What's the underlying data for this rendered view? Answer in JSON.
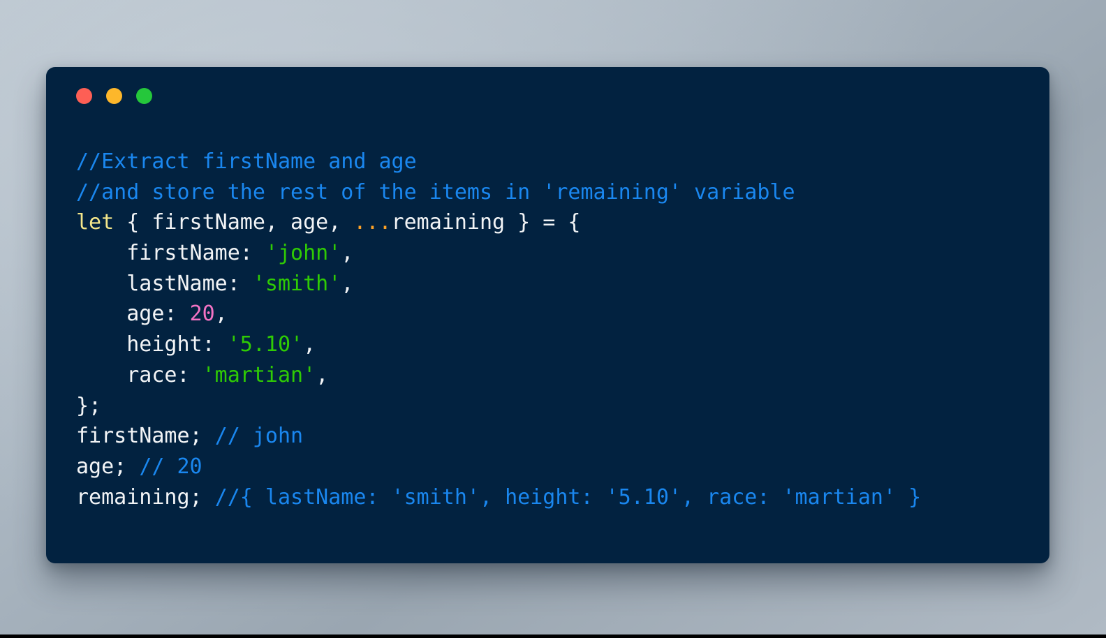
{
  "window": {
    "title": "",
    "traffic_lights": [
      {
        "name": "close",
        "color": "#fd5f55"
      },
      {
        "name": "minimize",
        "color": "#fdb72b"
      },
      {
        "name": "maximize",
        "color": "#25c73b"
      }
    ]
  },
  "theme": {
    "card_background": "#022240",
    "page_background_top": "#b9c4ce",
    "page_background_bottom": "#b0bac4",
    "text": "#f2f4f6",
    "comment": "#1a87ef",
    "keyword": "#f3e68a",
    "spread_operator": "#fda227",
    "string": "#2fcb04",
    "number": "#f373c4"
  },
  "code": {
    "language": "javascript",
    "plain_text": "//Extract firstName and age\n//and store the rest of the items in 'remaining' variable\nlet { firstName, age, ...remaining } = {\n    firstName: 'john',\n    lastName: 'smith',\n    age: 20,\n    height: '5.10',\n    race: 'martian',\n};\nfirstName; // john\nage; // 20\nremaining; //{ lastName: 'smith', height: '5.10', race: 'martian' }",
    "lines": [
      {
        "number": 1,
        "tokens": [
          {
            "t": "comment",
            "v": "//Extract firstName and age"
          }
        ]
      },
      {
        "number": 2,
        "tokens": [
          {
            "t": "comment",
            "v": "//and store the rest of the items in 'remaining' variable"
          }
        ]
      },
      {
        "number": 3,
        "tokens": [
          {
            "t": "kw",
            "v": "let"
          },
          {
            "t": "plain",
            "v": " { firstName, age, "
          },
          {
            "t": "spread",
            "v": "..."
          },
          {
            "t": "plain",
            "v": "remaining } = {"
          }
        ]
      },
      {
        "number": 4,
        "tokens": [
          {
            "t": "plain",
            "v": "    firstName: "
          },
          {
            "t": "str",
            "v": "'john'"
          },
          {
            "t": "plain",
            "v": ","
          }
        ]
      },
      {
        "number": 5,
        "tokens": [
          {
            "t": "plain",
            "v": "    lastName: "
          },
          {
            "t": "str",
            "v": "'smith'"
          },
          {
            "t": "plain",
            "v": ","
          }
        ]
      },
      {
        "number": 6,
        "tokens": [
          {
            "t": "plain",
            "v": "    age: "
          },
          {
            "t": "num",
            "v": "20"
          },
          {
            "t": "plain",
            "v": ","
          }
        ]
      },
      {
        "number": 7,
        "tokens": [
          {
            "t": "plain",
            "v": "    height: "
          },
          {
            "t": "str",
            "v": "'5.10'"
          },
          {
            "t": "plain",
            "v": ","
          }
        ]
      },
      {
        "number": 8,
        "tokens": [
          {
            "t": "plain",
            "v": "    race: "
          },
          {
            "t": "str",
            "v": "'martian'"
          },
          {
            "t": "plain",
            "v": ","
          }
        ]
      },
      {
        "number": 9,
        "tokens": [
          {
            "t": "plain",
            "v": "};"
          }
        ]
      },
      {
        "number": 10,
        "tokens": [
          {
            "t": "plain",
            "v": "firstName; "
          },
          {
            "t": "comment",
            "v": "// john"
          }
        ]
      },
      {
        "number": 11,
        "tokens": [
          {
            "t": "plain",
            "v": "age; "
          },
          {
            "t": "comment",
            "v": "// 20"
          }
        ]
      },
      {
        "number": 12,
        "tokens": [
          {
            "t": "plain",
            "v": "remaining; "
          },
          {
            "t": "comment",
            "v": "//{ lastName: 'smith', height: '5.10', race: 'martian' }"
          }
        ]
      }
    ]
  }
}
